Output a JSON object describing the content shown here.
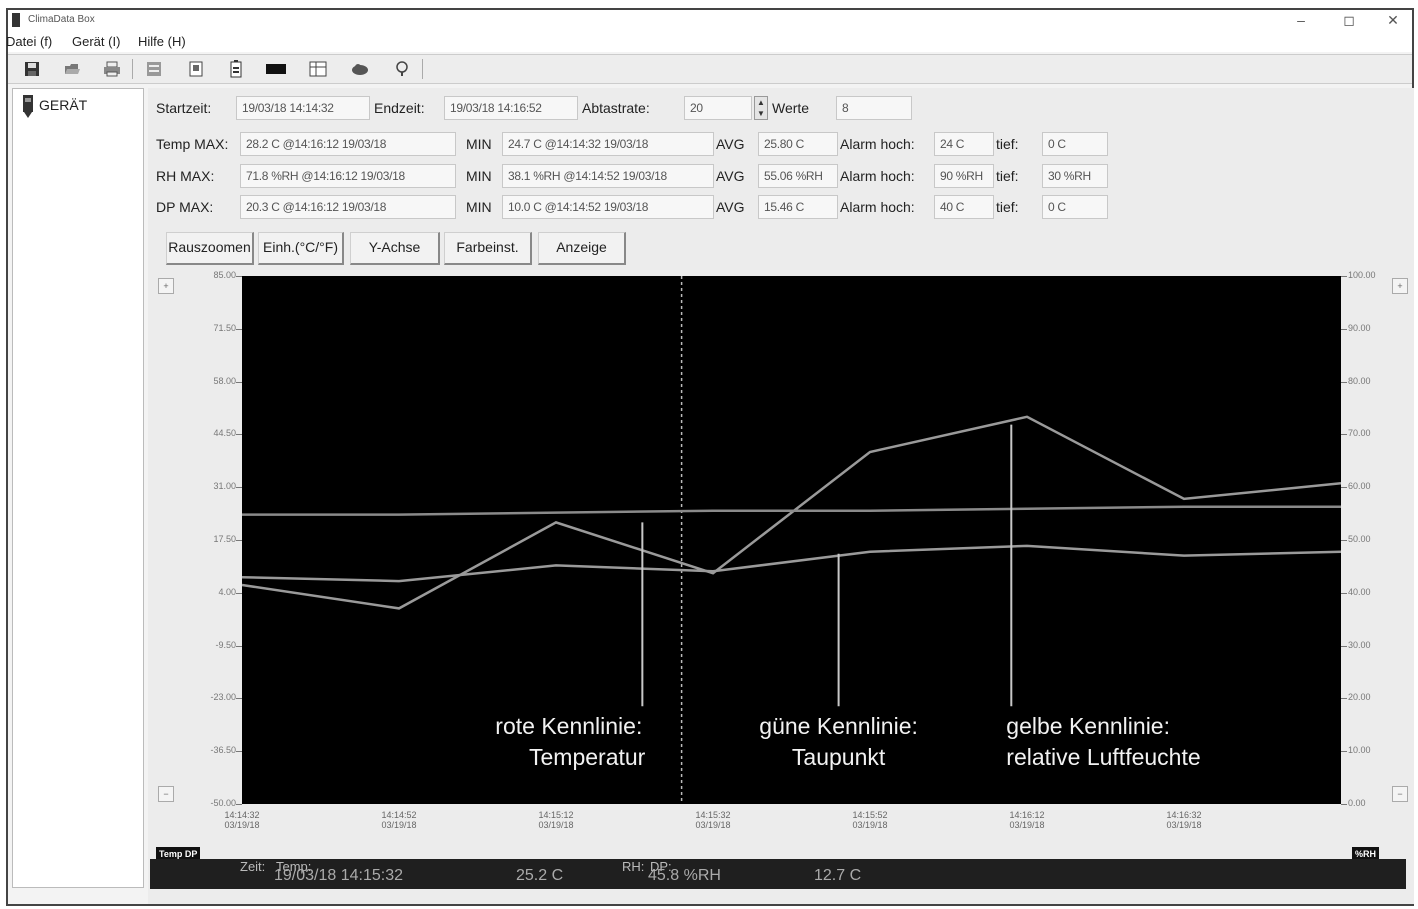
{
  "window": {
    "title": "ClimaData Box",
    "min": "–",
    "max": "◻",
    "close": "✕"
  },
  "menu": {
    "file": "Datei (f)",
    "device": "Gerät (I)",
    "help": "Hilfe (H)"
  },
  "toolbar": {
    "icons": [
      "save-icon",
      "open-icon",
      "print-icon",
      "import-icon",
      "export-icon",
      "battery-icon",
      "device-icon",
      "table-icon",
      "cloud-icon",
      "info-icon"
    ]
  },
  "tree": {
    "root": "GERÄT"
  },
  "info": {
    "start_label": "Startzeit:",
    "start_value": "19/03/18 14:14:32",
    "end_label": "Endzeit:",
    "end_value": "19/03/18 14:16:52",
    "rate_label": "Abtastrate:",
    "rate_value": "20",
    "count_label": "Werte",
    "count_value": "8",
    "rows": [
      {
        "label": "Temp MAX:",
        "max": "28.2 C @14:16:12 19/03/18",
        "min_label": "MIN",
        "min": "24.7 C @14:14:32 19/03/18",
        "avg_label": "AVG",
        "avg": "25.80 C",
        "alarm_label": "Alarm hoch:",
        "alarm_high": "24 C",
        "low_label": "tief:",
        "alarm_low": "0 C"
      },
      {
        "label": "RH MAX:",
        "max": "71.8 %RH @14:16:12 19/03/18",
        "min_label": "MIN",
        "min": "38.1 %RH @14:14:52 19/03/18",
        "avg_label": "AVG",
        "avg": "55.06 %RH",
        "alarm_label": "Alarm hoch:",
        "alarm_high": "90 %RH",
        "low_label": "tief:",
        "alarm_low": "30 %RH"
      },
      {
        "label": "DP MAX:",
        "max": "20.3 C @14:16:12 19/03/18",
        "min_label": "MIN",
        "min": "10.0 C @14:14:52 19/03/18",
        "avg_label": "AVG",
        "avg": "15.46 C",
        "alarm_label": "Alarm hoch:",
        "alarm_high": "40 C",
        "low_label": "tief:",
        "alarm_low": "0 C"
      }
    ]
  },
  "buttons": {
    "zoom_out": "Rauszoomen",
    "unit": "Einh.(°C/°F)",
    "yaxis": "Y-Achse",
    "color": "Farbeinst.",
    "display": "Anzeige"
  },
  "chart_data": {
    "type": "line",
    "x": [
      "14:14:32\n03/19/18",
      "14:14:52\n03/19/18",
      "14:15:12\n03/19/18",
      "14:15:32\n03/19/18",
      "14:15:52\n03/19/18",
      "14:16:12\n03/19/18",
      "14:16:32\n03/19/18"
    ],
    "x_full": [
      "14:14:32",
      "14:14:52",
      "14:15:12",
      "14:15:32",
      "14:15:52",
      "14:16:12",
      "14:16:32",
      "14:16:52"
    ],
    "yleft_ticks": [
      "85.00",
      "71.50",
      "58.00",
      "44.50",
      "31.00",
      "17.50",
      "4.00",
      "-9.50",
      "-23.00",
      "-36.50",
      "-50.00"
    ],
    "yright_ticks": [
      "100.00",
      "90.00",
      "80.00",
      "70.00",
      "60.00",
      "50.00",
      "40.00",
      "30.00",
      "20.00",
      "10.00",
      "0.00"
    ],
    "yleft_range": [
      -50,
      85
    ],
    "yright_range": [
      0,
      100
    ],
    "series": [
      {
        "axis": "left",
        "values": [
          8.0,
          7.0,
          11.0,
          9.5,
          14.5,
          16.0,
          13.5,
          14.5
        ]
      },
      {
        "axis": "left",
        "values": [
          6.0,
          0.0,
          22.0,
          9.0,
          40.0,
          49.0,
          28.0,
          32.0
        ]
      },
      {
        "axis": "left",
        "values": [
          24.0,
          24.0,
          24.5,
          25.0,
          25.0,
          25.5,
          26.0,
          26.0
        ]
      }
    ],
    "cursor_x": "14:15:28",
    "annotations": [
      {
        "line1": "rote Kennlinie:",
        "line2": "Temperatur",
        "x": "14:15:23",
        "y_from": -25,
        "y_to": 22
      },
      {
        "line1": "güne Kennlinie:",
        "line2": "Taupunkt",
        "x": "14:15:48",
        "y_from": -25,
        "y_to": 14
      },
      {
        "line1": "gelbe Kennlinie:",
        "line2": "relative Luftfeuchte",
        "x": "14:16:10",
        "y_from": -25,
        "y_to": 47
      }
    ],
    "left_legend": "Temp DP",
    "right_legend": "%RH",
    "left_scroll_up": "+",
    "left_scroll_down": "−",
    "right_scroll_up": "+",
    "right_scroll_down": "−"
  },
  "status": {
    "time_label": "Zeit:",
    "temp_label": "Temp:",
    "time_value": "19/03/18 14:15:32",
    "temp_value": "25.2 C",
    "rh_label": "RH:",
    "dp_label": "DP:",
    "rh_value": "45.8 %RH",
    "dp_value": "12.7 C"
  }
}
